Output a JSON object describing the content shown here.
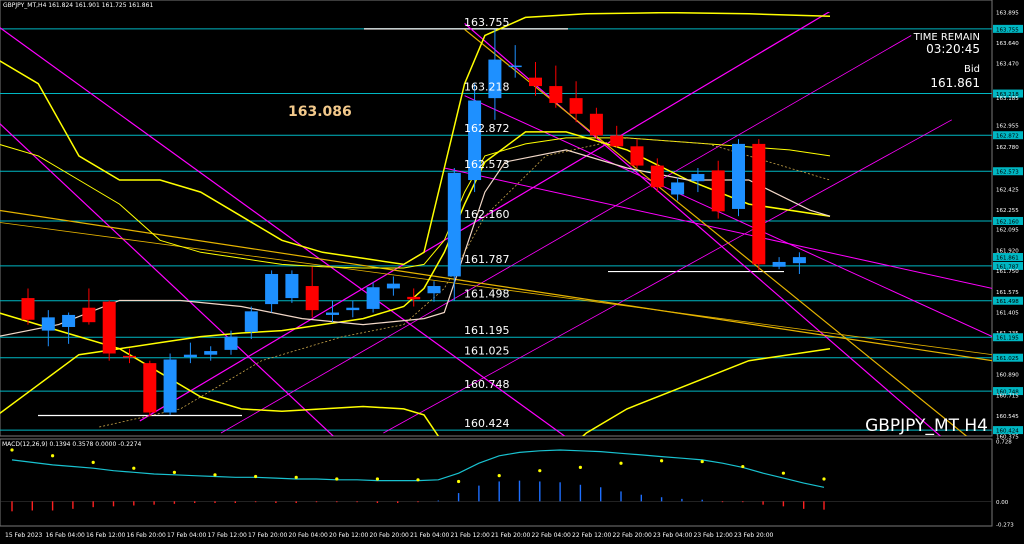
{
  "header": {
    "info": "GBPJPY_MT,H4  161.824 161.901 161.725 161.861",
    "time_remain_label": "TIME REMAIN",
    "time_remain_value": "03:20:45",
    "bid_label": "Bid",
    "bid_value": "161.861",
    "symbol_watermark": "GBPJPY_MT H4",
    "highlight_price": "163.086"
  },
  "colors": {
    "bg": "#000000",
    "bull": "#1e90ff",
    "bear": "#ff0000",
    "level": "#00b7c3",
    "magenta": "#ff00ff",
    "yellow": "#ffff00",
    "orange": "#e6b400",
    "ma_white": "#f2d8c8",
    "macd_line": "#19c2d0",
    "macd_dots": "#ffff00"
  },
  "chart_data": {
    "type": "candlestick",
    "symbol": "GBPJPY_MT",
    "timeframe": "H4",
    "price_range": [
      160.375,
      163.895
    ],
    "x_labels": [
      "15 Feb 2023",
      "16 Feb 04:00",
      "16 Feb 12:00",
      "16 Feb 20:00",
      "17 Feb 04:00",
      "17 Feb 12:00",
      "17 Feb 20:00",
      "20 Feb 04:00",
      "20 Feb 12:00",
      "20 Feb 20:00",
      "21 Feb 04:00",
      "21 Feb 12:00",
      "21 Feb 20:00",
      "22 Feb 04:00",
      "22 Feb 12:00",
      "22 Feb 20:00",
      "23 Feb 04:00",
      "23 Feb 12:00",
      "23 Feb 20:00"
    ],
    "y_ticks": [
      "163.895",
      "163.755",
      "163.640",
      "163.470",
      "163.218",
      "163.185",
      "162.955",
      "162.872",
      "162.780",
      "162.573",
      "162.425",
      "162.255",
      "162.160",
      "162.095",
      "161.920",
      "161.861",
      "161.787",
      "161.750",
      "161.575",
      "161.498",
      "161.405",
      "161.235",
      "161.195",
      "161.025",
      "160.890",
      "160.748",
      "160.715",
      "160.545",
      "160.424",
      "160.375"
    ],
    "highlighted_ticks": [
      "163.755",
      "163.218",
      "162.872",
      "162.573",
      "162.160",
      "161.861",
      "161.787",
      "161.498",
      "161.195",
      "161.025",
      "160.748",
      "160.424"
    ],
    "levels": [
      {
        "label": "163.755",
        "price": 163.755
      },
      {
        "label": "163.218",
        "price": 163.218
      },
      {
        "label": "162.872",
        "price": 162.872
      },
      {
        "label": "162.573",
        "price": 162.573
      },
      {
        "label": "162.160",
        "price": 162.16
      },
      {
        "label": "161.787",
        "price": 161.787
      },
      {
        "label": "161.498",
        "price": 161.498
      },
      {
        "label": "161.195",
        "price": 161.195
      },
      {
        "label": "161.025",
        "price": 161.025
      },
      {
        "label": "160.748",
        "price": 160.748
      },
      {
        "label": "160.424",
        "price": 160.424
      }
    ],
    "candles": [
      {
        "o": 161.52,
        "h": 161.6,
        "l": 161.3,
        "c": 161.34
      },
      {
        "o": 161.25,
        "h": 161.42,
        "l": 161.12,
        "c": 161.36
      },
      {
        "o": 161.28,
        "h": 161.4,
        "l": 161.14,
        "c": 161.38
      },
      {
        "o": 161.44,
        "h": 161.6,
        "l": 161.3,
        "c": 161.32
      },
      {
        "o": 161.49,
        "h": 161.5,
        "l": 161.0,
        "c": 161.06
      },
      {
        "o": 161.04,
        "h": 161.1,
        "l": 160.98,
        "c": 161.03
      },
      {
        "o": 160.98,
        "h": 161.0,
        "l": 160.54,
        "c": 160.57
      },
      {
        "o": 160.57,
        "h": 161.06,
        "l": 160.55,
        "c": 161.01
      },
      {
        "o": 161.03,
        "h": 161.15,
        "l": 160.98,
        "c": 161.05
      },
      {
        "o": 161.05,
        "h": 161.12,
        "l": 161.0,
        "c": 161.08
      },
      {
        "o": 161.09,
        "h": 161.25,
        "l": 161.05,
        "c": 161.2
      },
      {
        "o": 161.24,
        "h": 161.45,
        "l": 161.18,
        "c": 161.41
      },
      {
        "o": 161.47,
        "h": 161.75,
        "l": 161.4,
        "c": 161.72
      },
      {
        "o": 161.52,
        "h": 161.75,
        "l": 161.48,
        "c": 161.72
      },
      {
        "o": 161.62,
        "h": 161.78,
        "l": 161.36,
        "c": 161.42
      },
      {
        "o": 161.38,
        "h": 161.5,
        "l": 161.32,
        "c": 161.4
      },
      {
        "o": 161.42,
        "h": 161.5,
        "l": 161.36,
        "c": 161.44
      },
      {
        "o": 161.43,
        "h": 161.65,
        "l": 161.4,
        "c": 161.61
      },
      {
        "o": 161.6,
        "h": 161.7,
        "l": 161.54,
        "c": 161.64
      },
      {
        "o": 161.53,
        "h": 161.6,
        "l": 161.45,
        "c": 161.51
      },
      {
        "o": 161.56,
        "h": 161.66,
        "l": 161.49,
        "c": 161.62
      },
      {
        "o": 161.7,
        "h": 162.6,
        "l": 161.5,
        "c": 162.56
      },
      {
        "o": 162.5,
        "h": 163.3,
        "l": 162.4,
        "c": 163.16
      },
      {
        "o": 163.18,
        "h": 163.75,
        "l": 163.0,
        "c": 163.5
      },
      {
        "o": 163.45,
        "h": 163.62,
        "l": 163.35,
        "c": 163.45
      },
      {
        "o": 163.35,
        "h": 163.48,
        "l": 163.2,
        "c": 163.28
      },
      {
        "o": 163.28,
        "h": 163.45,
        "l": 163.1,
        "c": 163.14
      },
      {
        "o": 163.18,
        "h": 163.32,
        "l": 162.98,
        "c": 163.05
      },
      {
        "o": 163.05,
        "h": 163.1,
        "l": 162.84,
        "c": 162.87
      },
      {
        "o": 162.87,
        "h": 162.95,
        "l": 162.77,
        "c": 162.78
      },
      {
        "o": 162.78,
        "h": 162.84,
        "l": 162.6,
        "c": 162.62
      },
      {
        "o": 162.62,
        "h": 162.68,
        "l": 162.4,
        "c": 162.44
      },
      {
        "o": 162.38,
        "h": 162.52,
        "l": 162.33,
        "c": 162.48
      },
      {
        "o": 162.49,
        "h": 162.6,
        "l": 162.4,
        "c": 162.55
      },
      {
        "o": 162.58,
        "h": 162.66,
        "l": 162.18,
        "c": 162.24
      },
      {
        "o": 162.26,
        "h": 162.84,
        "l": 162.2,
        "c": 162.8
      },
      {
        "o": 162.8,
        "h": 162.84,
        "l": 161.75,
        "c": 161.8
      },
      {
        "o": 161.78,
        "h": 161.86,
        "l": 161.76,
        "c": 161.82
      },
      {
        "o": 161.81,
        "h": 161.9,
        "l": 161.72,
        "c": 161.86
      }
    ],
    "macd": {
      "label": "MACD(12,26,9) 0.1394 0.3578 0.0000 -0.2274",
      "range": [
        -0.273,
        0.728
      ],
      "y_ticks": [
        "0.728",
        "0.00",
        "-0.273"
      ],
      "signal": [
        0.62,
        0.58,
        0.55,
        0.51,
        0.47,
        0.43,
        0.4,
        0.37,
        0.35,
        0.33,
        0.32,
        0.31,
        0.3,
        0.3,
        0.29,
        0.28,
        0.27,
        0.27,
        0.27,
        0.27,
        0.26,
        0.25,
        0.24,
        0.27,
        0.31,
        0.34,
        0.37,
        0.39,
        0.41,
        0.43,
        0.46,
        0.48,
        0.49,
        0.49,
        0.48,
        0.45,
        0.42,
        0.38,
        0.34,
        0.31,
        0.27
      ],
      "macd_line": [
        0.5,
        0.47,
        0.44,
        0.42,
        0.4,
        0.37,
        0.35,
        0.33,
        0.32,
        0.31,
        0.3,
        0.29,
        0.29,
        0.28,
        0.27,
        0.27,
        0.26,
        0.26,
        0.25,
        0.25,
        0.25,
        0.26,
        0.34,
        0.46,
        0.55,
        0.59,
        0.61,
        0.62,
        0.61,
        0.6,
        0.58,
        0.56,
        0.54,
        0.52,
        0.5,
        0.46,
        0.41,
        0.34,
        0.28,
        0.22,
        0.17
      ],
      "histogram": [
        -0.12,
        -0.11,
        -0.11,
        -0.09,
        -0.07,
        -0.06,
        -0.05,
        -0.04,
        -0.03,
        -0.02,
        -0.02,
        -0.02,
        -0.01,
        -0.02,
        -0.02,
        -0.01,
        -0.01,
        -0.01,
        -0.02,
        -0.02,
        -0.01,
        0.01,
        0.1,
        0.19,
        0.24,
        0.25,
        0.24,
        0.23,
        0.2,
        0.17,
        0.12,
        0.08,
        0.05,
        0.03,
        0.02,
        -0.01,
        -0.01,
        -0.04,
        -0.06,
        -0.09,
        -0.1
      ]
    }
  }
}
